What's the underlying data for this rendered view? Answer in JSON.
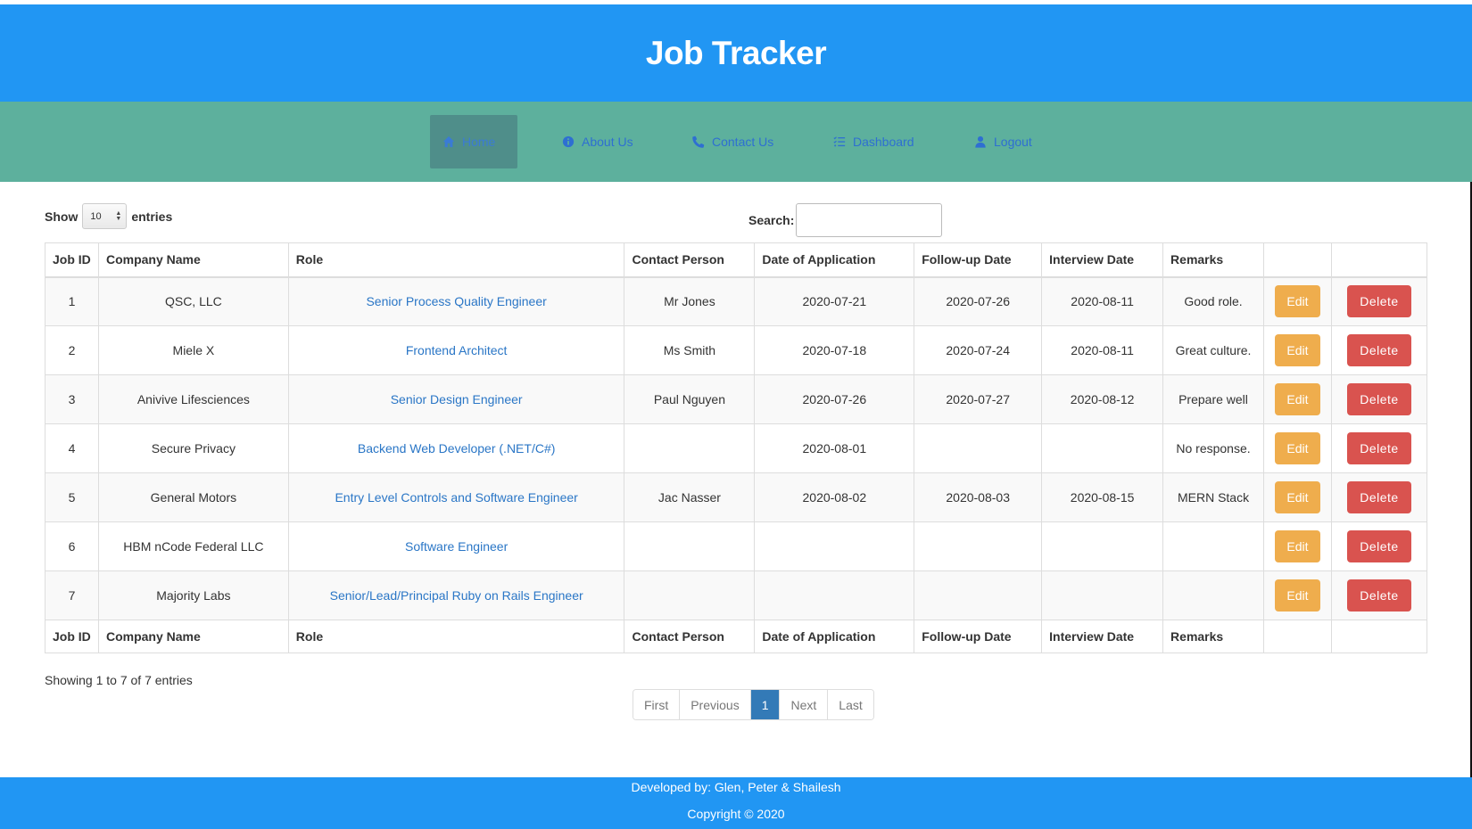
{
  "header": {
    "title": "Job Tracker"
  },
  "nav": {
    "items": [
      {
        "label": "Home",
        "icon": "home-icon",
        "active": true
      },
      {
        "label": "About Us",
        "icon": "info-circle-icon"
      },
      {
        "label": "Contact Us",
        "icon": "phone-icon"
      },
      {
        "label": "Dashboard",
        "icon": "tasks-list-icon"
      },
      {
        "label": "Logout",
        "icon": "user-icon"
      }
    ]
  },
  "controls": {
    "show_label": "Show",
    "entries_label": "entries",
    "length_value": "10",
    "search_label": "Search:",
    "search_value": ""
  },
  "table": {
    "columns": [
      "Job ID",
      "Company Name",
      "Role",
      "Contact Person",
      "Date of Application",
      "Follow-up Date",
      "Interview Date",
      "Remarks",
      "",
      ""
    ],
    "edit_label": "Edit",
    "delete_label": "Delete",
    "rows": [
      {
        "id": "1",
        "company": "QSC, LLC",
        "role": "Senior Process Quality Engineer",
        "contact": "Mr Jones",
        "applied": "2020-07-21",
        "followup": "2020-07-26",
        "interview": "2020-08-11",
        "remarks": "Good role."
      },
      {
        "id": "2",
        "company": "Miele X",
        "role": "Frontend Architect",
        "contact": "Ms Smith",
        "applied": "2020-07-18",
        "followup": "2020-07-24",
        "interview": "2020-08-11",
        "remarks": "Great culture."
      },
      {
        "id": "3",
        "company": "Anivive Lifesciences",
        "role": "Senior Design Engineer",
        "contact": "Paul Nguyen",
        "applied": "2020-07-26",
        "followup": "2020-07-27",
        "interview": "2020-08-12",
        "remarks": "Prepare well"
      },
      {
        "id": "4",
        "company": "Secure Privacy",
        "role": "Backend Web Developer (.NET/C#)",
        "contact": "",
        "applied": "2020-08-01",
        "followup": "",
        "interview": "",
        "remarks": "No response."
      },
      {
        "id": "5",
        "company": "General Motors",
        "role": "Entry Level Controls and Software Engineer",
        "contact": "Jac Nasser",
        "applied": "2020-08-02",
        "followup": "2020-08-03",
        "interview": "2020-08-15",
        "remarks": "MERN Stack"
      },
      {
        "id": "6",
        "company": "HBM nCode Federal LLC",
        "role": "Software Engineer",
        "contact": "",
        "applied": "",
        "followup": "",
        "interview": "",
        "remarks": ""
      },
      {
        "id": "7",
        "company": "Majority Labs",
        "role": "Senior/Lead/Principal Ruby on Rails Engineer",
        "contact": "",
        "applied": "",
        "followup": "",
        "interview": "",
        "remarks": ""
      }
    ]
  },
  "info": "Showing 1 to 7 of 7 entries",
  "pagination": {
    "first": "First",
    "previous": "Previous",
    "current": "1",
    "next": "Next",
    "last": "Last"
  },
  "footer": {
    "line1": "Developed by: Glen, Peter & Shailesh",
    "line2": "Copyright © 2020"
  },
  "colors": {
    "header": "#2196f3",
    "nav": "#5db09d",
    "link": "#2a76c6",
    "edit": "#efad4d",
    "delete": "#d9534f",
    "page_active": "#337ab7"
  }
}
